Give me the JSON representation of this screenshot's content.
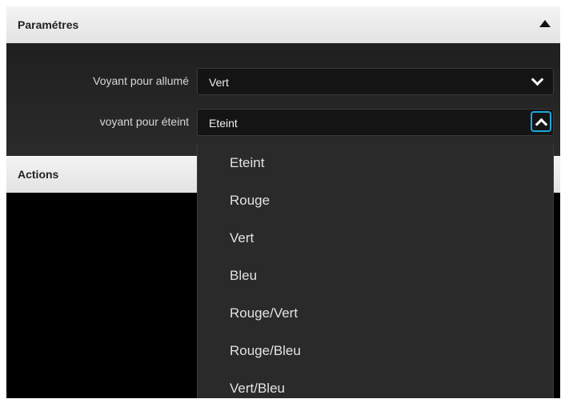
{
  "params": {
    "header": "Paramétres",
    "collapse_icon": "triangle-up-icon",
    "fields": [
      {
        "label": "Voyant pour allumé",
        "value": "Vert",
        "icon": "chevron-down-icon"
      },
      {
        "label": "voyant pour éteint",
        "value": "Eteint",
        "icon": "chevron-up-icon"
      }
    ]
  },
  "actions": {
    "header": "Actions"
  },
  "dropdown": {
    "options": [
      "Eteint",
      "Rouge",
      "Vert",
      "Bleu",
      "Rouge/Vert",
      "Rouge/Bleu",
      "Vert/Bleu"
    ]
  },
  "colors": {
    "header_bg": "#ececec",
    "panel_bg": "#252525",
    "dropdown_bg": "#2a2a2a",
    "focus_accent": "#1aa8e0"
  }
}
